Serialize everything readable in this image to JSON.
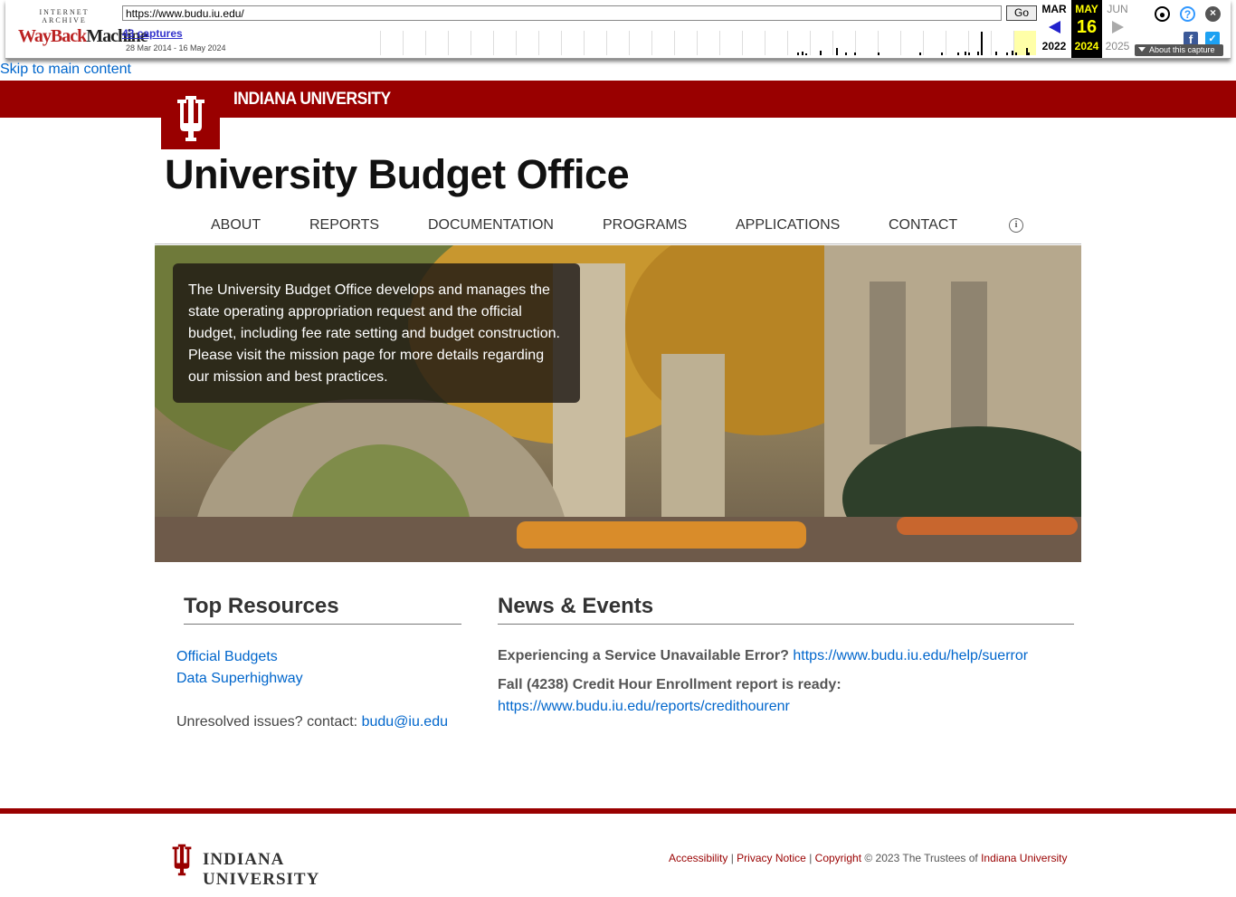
{
  "wayback": {
    "logo_top": "INTERNET ARCHIVE",
    "logo_main": "WayBack",
    "logo_main2": "Machine",
    "url": "https://www.budu.iu.edu/",
    "go_label": "Go",
    "captures": "43 captures",
    "date_range": "28 Mar 2014 - 16 May 2024",
    "prev_month": "MAR",
    "prev_year": "2022",
    "cur_month": "MAY",
    "cur_day": "16",
    "cur_year": "2024",
    "next_month": "JUN",
    "next_year": "2025",
    "about_label": "About this capture",
    "icons": [
      "user-icon",
      "help-icon",
      "close-icon",
      "facebook-icon",
      "twitter-icon"
    ]
  },
  "skip_link": "Skip to main content",
  "header": {
    "university": "INDIANA UNIVERSITY",
    "site_title": "University Budget Office",
    "brand_color": "#990000"
  },
  "nav": {
    "items": [
      "ABOUT",
      "REPORTS",
      "DOCUMENTATION",
      "PROGRAMS",
      "APPLICATIONS",
      "CONTACT"
    ],
    "info_glyph": "i"
  },
  "hero": {
    "text": "The University Budget Office develops and manages the state operating appropriation request and the official budget, including fee rate setting and budget construction. Please visit the mission page for more details regarding our mission and best practices."
  },
  "resources": {
    "heading": "Top Resources",
    "links": [
      "Official Budgets",
      "Data Superhighway"
    ],
    "unresolved_prefix": "Unresolved issues? contact:",
    "email": "budu@iu.edu"
  },
  "news": {
    "heading": "News & Events",
    "items": [
      {
        "title": "Experiencing a Service Unavailable Error?",
        "link": "https://www.budu.iu.edu/help/suerror"
      },
      {
        "title": "Fall (4238) Credit Hour Enrollment report is ready:",
        "link": "https://www.budu.iu.edu/reports/credithourenr"
      }
    ]
  },
  "footer": {
    "logo_text": "INDIANA UNIVERSITY",
    "accessibility": "Accessibility",
    "privacy": "Privacy Notice",
    "copyright": "Copyright",
    "copy_text": "© 2023 The Trustees of",
    "iu_link": "Indiana University",
    "sep": "|"
  }
}
